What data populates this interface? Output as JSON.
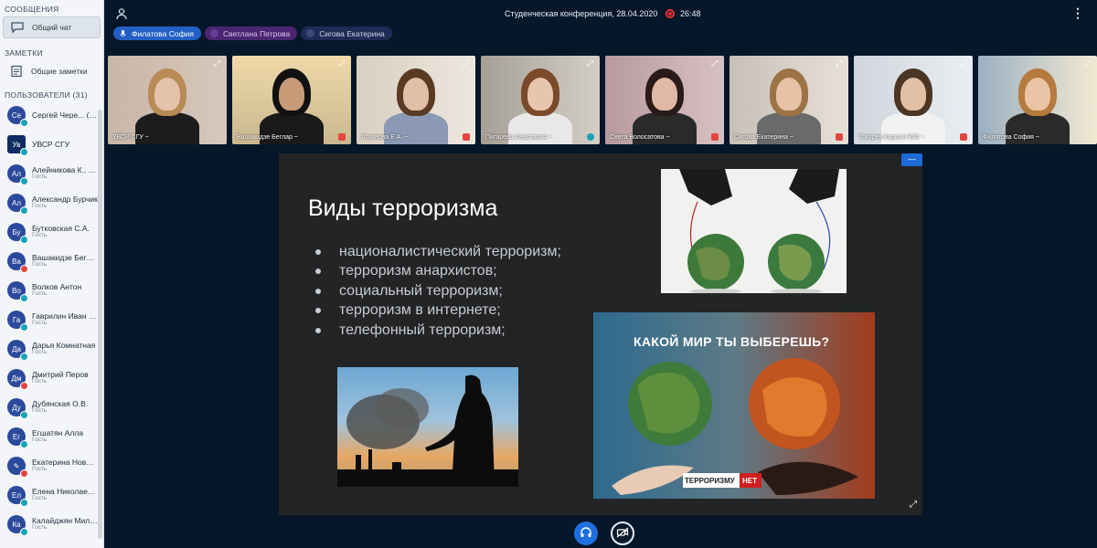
{
  "sidebar": {
    "messages_heading": "СООБЩЕНИЯ",
    "general_chat": "Общий чат",
    "notes_heading": "ЗАМЕТКИ",
    "general_notes": "Общие заметки",
    "users_heading": "ПОЛЬЗОВАТЕЛИ (31)",
    "users": [
      {
        "initials": "Се",
        "name": "Сергей Черe... (Вы)",
        "role": "",
        "status": "teal"
      },
      {
        "initials": "Ув",
        "name": "УВСР СГУ",
        "role": "",
        "status": "teal",
        "square": true
      },
      {
        "initials": "Ал",
        "name": "Алейникова К., Зу...",
        "role": "Гость",
        "status": "teal"
      },
      {
        "initials": "Ал",
        "name": "Александр Бурчик",
        "role": "Гость",
        "status": "teal"
      },
      {
        "initials": "Бу",
        "name": "Бутковская С.А.",
        "role": "Гость",
        "status": "teal"
      },
      {
        "initials": "Ва",
        "name": "Вашакидзе Беглар",
        "role": "Гость",
        "status": "red"
      },
      {
        "initials": "Во",
        "name": "Волков Антон",
        "role": "Гость",
        "status": "teal"
      },
      {
        "initials": "Га",
        "name": "Гаврилин Иван А...",
        "role": "Гость",
        "status": "teal"
      },
      {
        "initials": "Да",
        "name": "Дарья Комнатная",
        "role": "Гость",
        "status": "teal"
      },
      {
        "initials": "Дм",
        "name": "Дмитрий Перов",
        "role": "Гость",
        "status": "red"
      },
      {
        "initials": "Ду",
        "name": "Дубянская О.В.",
        "role": "Гость",
        "status": "teal"
      },
      {
        "initials": "Ег",
        "name": "Егшатян Алла",
        "role": "Гость",
        "status": "teal"
      },
      {
        "initials": "✎",
        "name": "Екатерина Новик...",
        "role": "Гость",
        "status": "red"
      },
      {
        "initials": "Ел",
        "name": "Елена Николаевна",
        "role": "Гость",
        "status": "teal"
      },
      {
        "initials": "Ка",
        "name": "Калайджян Милена",
        "role": "Гость",
        "status": "teal"
      }
    ]
  },
  "topbar": {
    "conference_title": "Студенческая конференция, 28.04.2020",
    "timer": "26:48"
  },
  "speakers": [
    {
      "name": "Филатова София",
      "active": true
    },
    {
      "name": "Светлана Петрова",
      "active": false
    },
    {
      "name": "Сигова Екатерина",
      "active": false
    }
  ],
  "participants": [
    {
      "label": "УВСР СГУ ~",
      "mic": "none"
    },
    {
      "label": "Вашакидзе Беглар ~",
      "mic": "red"
    },
    {
      "label": "Логинова Е.А. ~",
      "mic": "red"
    },
    {
      "label": "Пигарева Анастасия ~",
      "mic": "teal"
    },
    {
      "label": "Света Волосатова ~",
      "mic": "red"
    },
    {
      "label": "Сигова Екатерина ~",
      "mic": "red"
    },
    {
      "label": "Токарев Кирилл ЮФ ~",
      "mic": "red"
    },
    {
      "label": "Филатова София ~",
      "mic": "none"
    }
  ],
  "slide": {
    "title": "Виды терроризма",
    "bullets": [
      "националистический терроризм;",
      "терроризм анархистов;",
      "социальный терроризм;",
      "терроризм в интернете;",
      "телефонный терроризм;"
    ],
    "poster_headline": "КАКОЙ МИР ТЫ ВЫБЕРЕШЬ?",
    "poster_logo_left": "ТЕРРОРИЗМУ",
    "poster_logo_right": "НЕТ"
  },
  "stage_button": "—",
  "colors": {
    "accent": "#1e6fe0",
    "background": "#06172a",
    "sidebar": "#f3f5f8",
    "record": "#e33333"
  }
}
